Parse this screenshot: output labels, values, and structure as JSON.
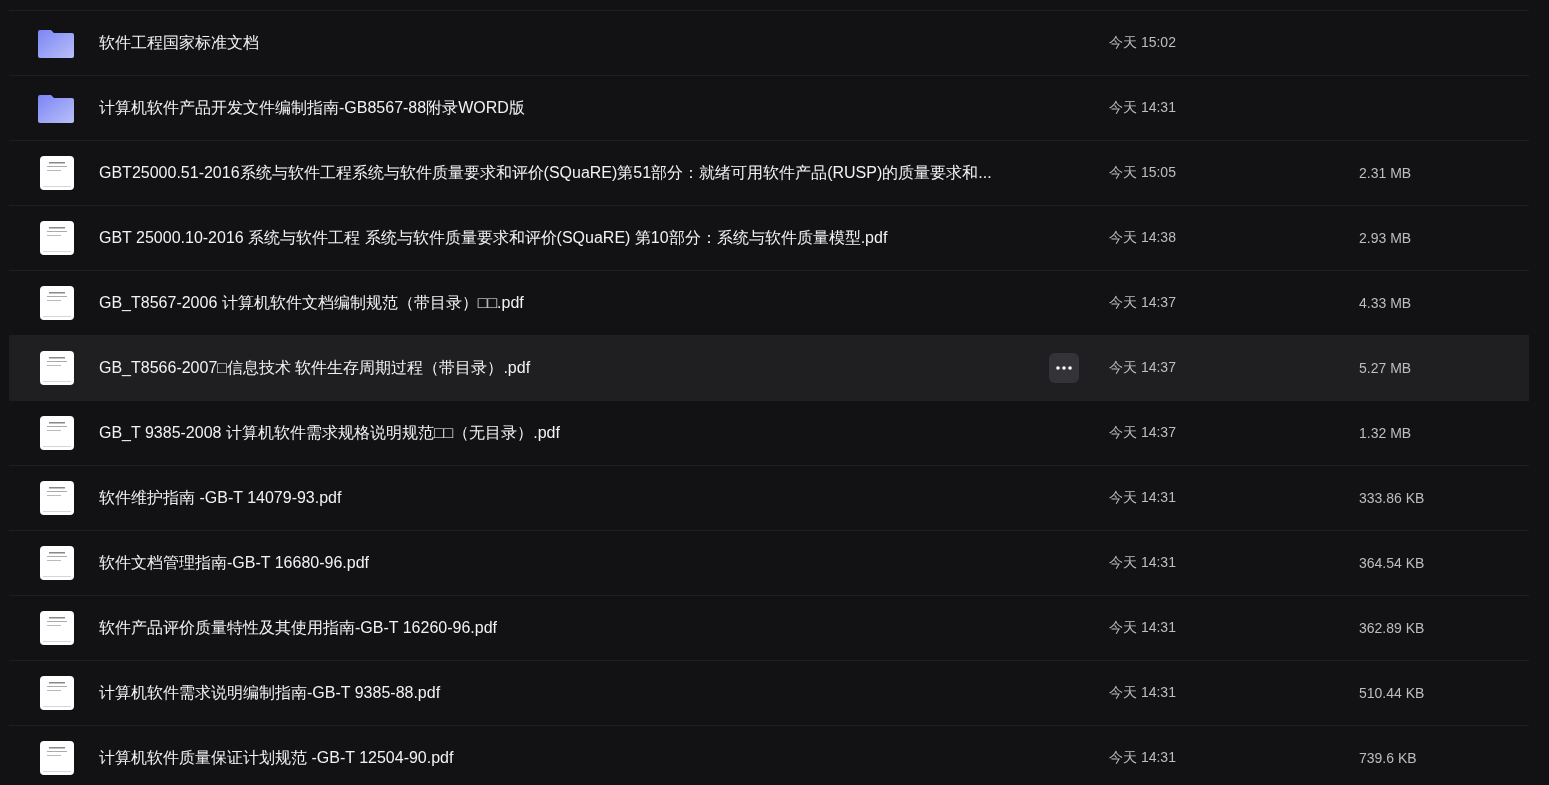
{
  "files": [
    {
      "kind": "folder",
      "name": "软件工程国家标准文档",
      "time": "今天 15:02",
      "highlighted": false
    },
    {
      "kind": "folder",
      "name": "计算机软件产品开发文件编制指南-GB8567-88附录WORD版",
      "time": "今天 14:31",
      "highlighted": false
    },
    {
      "kind": "file",
      "name": "GBT25000.51-2016系统与软件工程系统与软件质量要求和评价(SQuaRE)第51部分：就绪可用软件产品(RUSP)的质量要求和...",
      "time": "今天 15:05",
      "size": "2.31 MB",
      "highlighted": false
    },
    {
      "kind": "file",
      "name": "GBT 25000.10-2016 系统与软件工程 系统与软件质量要求和评价(SQuaRE) 第10部分：系统与软件质量模型.pdf",
      "time": "今天 14:38",
      "size": "2.93 MB",
      "highlighted": false
    },
    {
      "kind": "file",
      "name": "GB_T8567-2006 计算机软件文档编制规范（带目录）□□.pdf",
      "time": "今天 14:37",
      "size": "4.33 MB",
      "highlighted": false
    },
    {
      "kind": "file",
      "name": "GB_T8566-2007□信息技术 软件生存周期过程（带目录）.pdf",
      "time": "今天 14:37",
      "size": "5.27 MB",
      "highlighted": true
    },
    {
      "kind": "file",
      "name": "GB_T 9385-2008 计算机软件需求规格说明规范□□（无目录）.pdf",
      "time": "今天 14:37",
      "size": "1.32 MB",
      "highlighted": false
    },
    {
      "kind": "file",
      "name": "软件维护指南 -GB-T 14079-93.pdf",
      "time": "今天 14:31",
      "size": "333.86 KB",
      "highlighted": false
    },
    {
      "kind": "file",
      "name": "软件文档管理指南-GB-T 16680-96.pdf",
      "time": "今天 14:31",
      "size": "364.54 KB",
      "highlighted": false
    },
    {
      "kind": "file",
      "name": "软件产品评价质量特性及其使用指南-GB-T 16260-96.pdf",
      "time": "今天 14:31",
      "size": "362.89 KB",
      "highlighted": false
    },
    {
      "kind": "file",
      "name": "计算机软件需求说明编制指南-GB-T 9385-88.pdf",
      "time": "今天 14:31",
      "size": "510.44 KB",
      "highlighted": false
    },
    {
      "kind": "file",
      "name": "计算机软件质量保证计划规范 -GB-T 12504-90.pdf",
      "time": "今天 14:31",
      "size": "739.6 KB",
      "highlighted": false
    }
  ]
}
